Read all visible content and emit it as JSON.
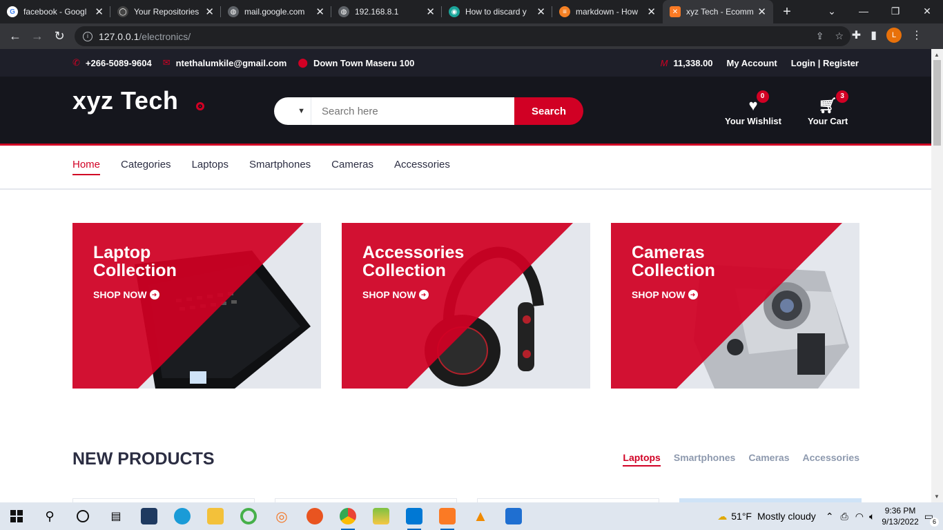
{
  "browser": {
    "tabs": [
      {
        "title": "facebook - Googl",
        "favicon_color": "#4285f4",
        "favicon_glyph": "G"
      },
      {
        "title": "Your Repositories",
        "favicon_color": "#555555",
        "favicon_glyph": "◯"
      },
      {
        "title": "mail.google.com",
        "favicon_color": "#5f6368",
        "favicon_glyph": "◍"
      },
      {
        "title": "192.168.8.1",
        "favicon_color": "#5f6368",
        "favicon_glyph": "◍"
      },
      {
        "title": "How to discard y",
        "favicon_color": "#1aa59a",
        "favicon_glyph": "◉"
      },
      {
        "title": "markdown - How",
        "favicon_color": "#f48024",
        "favicon_glyph": "≡"
      },
      {
        "title": "xyz Tech - Ecomm",
        "favicon_color": "#fb7a24",
        "favicon_glyph": "✕"
      }
    ],
    "active_tab": 6,
    "new_tab": "+",
    "url_host": "127.0.0.1",
    "url_path": "/electronics/",
    "profile_initial": "L"
  },
  "topbar": {
    "phone": "+266-5089-9604",
    "email": "ntethalumkile@gmail.com",
    "location": "Down Town Maseru 100",
    "currency_symbol": "M",
    "balance": "11,338.00",
    "account": "My Account",
    "login": "Login | Register"
  },
  "header": {
    "logo": "xyz Tech",
    "search_placeholder": "Search here",
    "search_button": "Search",
    "wishlist_label": "Your Wishlist",
    "wishlist_count": "0",
    "cart_label": "Your Cart",
    "cart_count": "3"
  },
  "nav": {
    "items": [
      "Home",
      "Categories",
      "Laptops",
      "Smartphones",
      "Cameras",
      "Accessories"
    ],
    "active": 0
  },
  "collections": [
    {
      "line1": "Laptop",
      "line2": "Collection",
      "cta": "SHOP NOW",
      "product_icon": "laptop"
    },
    {
      "line1": "Accessories",
      "line2": "Collection",
      "cta": "SHOP NOW",
      "product_icon": "headphones"
    },
    {
      "line1": "Cameras",
      "line2": "Collection",
      "cta": "SHOP NOW",
      "product_icon": "camera"
    }
  ],
  "new_products": {
    "title": "NEW PRODUCTS",
    "tabs": [
      "Laptops",
      "Smartphones",
      "Cameras",
      "Accessories"
    ],
    "active": 0
  },
  "taskbar": {
    "weather_temp": "51°F",
    "weather_text": "Mostly cloudy",
    "time": "9:36 PM",
    "date": "9/13/2022",
    "notifications": "6"
  },
  "colors": {
    "brand_red": "#d10024",
    "header_dark": "#15161d",
    "topbar_dark": "#1e1f29"
  }
}
